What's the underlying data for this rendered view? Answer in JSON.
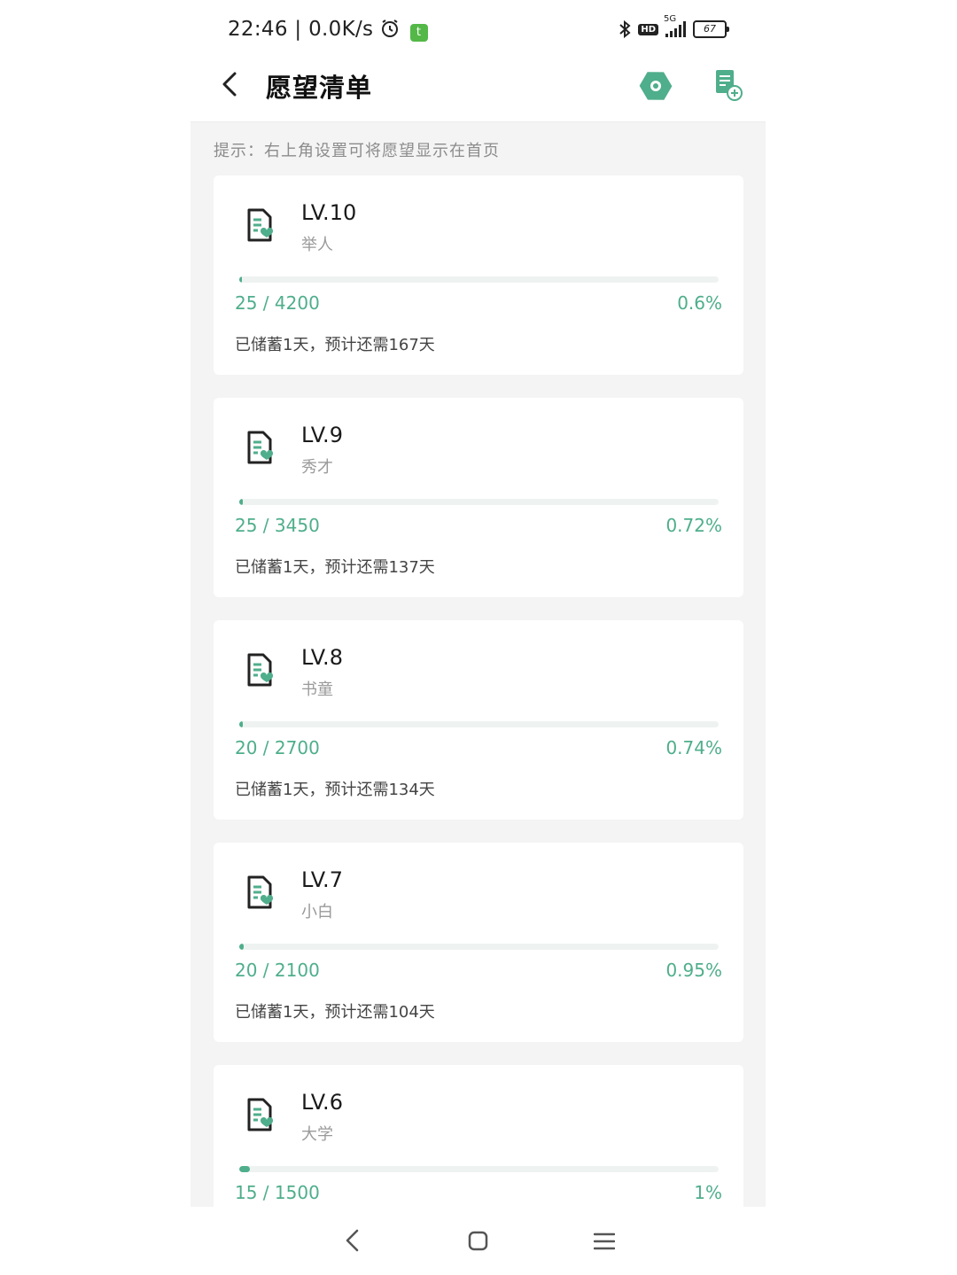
{
  "status_bar": {
    "time": "22:46",
    "net_speed": "0.0K/s",
    "network": "5G",
    "hd": "HD",
    "battery": "67"
  },
  "header": {
    "title": "愿望清单"
  },
  "tip": "提示：右上角设置可将愿望显示在首页",
  "accent_color": "#4fae8b",
  "cards": [
    {
      "level": "LV.10",
      "title": "举人",
      "amount": "25 / 4200",
      "percent": "0.6%",
      "progress": 0.006,
      "days": "已储蓄1天，预计还需167天"
    },
    {
      "level": "LV.9",
      "title": "秀才",
      "amount": "25 / 3450",
      "percent": "0.72%",
      "progress": 0.0072,
      "days": "已储蓄1天，预计还需137天"
    },
    {
      "level": "LV.8",
      "title": "书童",
      "amount": "20 / 2700",
      "percent": "0.74%",
      "progress": 0.0074,
      "days": "已储蓄1天，预计还需134天"
    },
    {
      "level": "LV.7",
      "title": "小白",
      "amount": "20 / 2100",
      "percent": "0.95%",
      "progress": 0.0095,
      "days": "已储蓄1天，预计还需104天"
    },
    {
      "level": "LV.6",
      "title": "大学",
      "amount": "15 / 1500",
      "percent": "1%",
      "progress": 0.01,
      "days": ""
    }
  ]
}
